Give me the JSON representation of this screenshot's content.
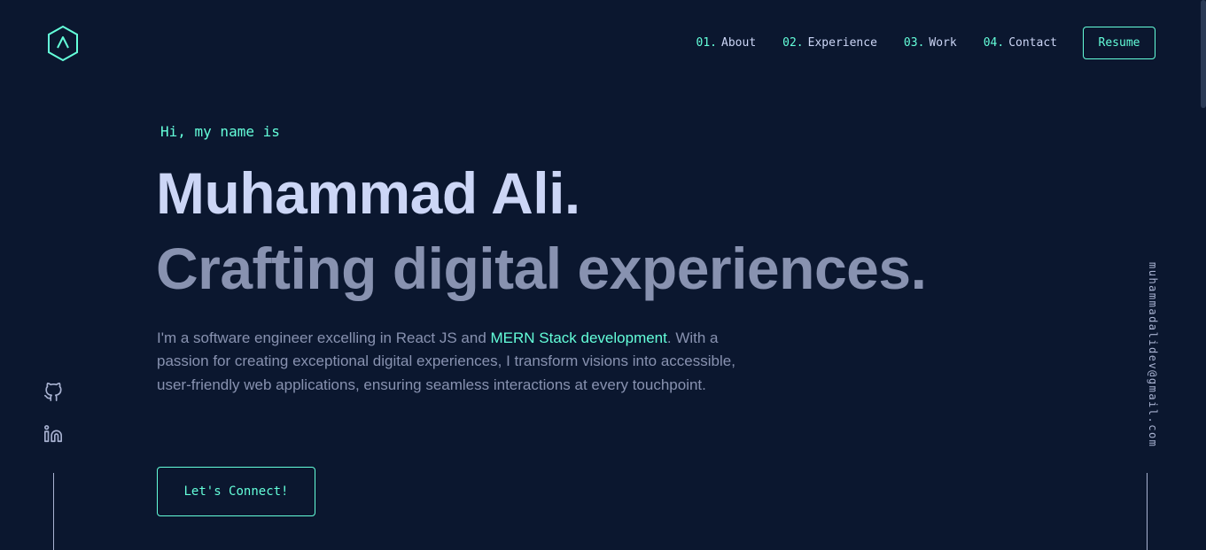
{
  "brand": {
    "logo_icon": "hexagon-logo-icon",
    "letter_icon": "chevron-up-icon"
  },
  "nav": {
    "items": [
      {
        "num": "01.",
        "label": "About"
      },
      {
        "num": "02.",
        "label": "Experience"
      },
      {
        "num": "03.",
        "label": "Work"
      },
      {
        "num": "04.",
        "label": "Contact"
      }
    ],
    "resume_label": "Resume"
  },
  "hero": {
    "greeting": "Hi, my name is",
    "name": "Muhammad Ali.",
    "tagline": "Crafting digital experiences.",
    "bio_part1": "I'm a software engineer excelling in React JS and ",
    "bio_highlight": "MERN Stack development",
    "bio_part2": ". With a passion for creating exceptional digital experiences, I transform visions into accessible, user-friendly web applications, ensuring seamless interactions at every touchpoint.",
    "cta_label": "Let's Connect!"
  },
  "socials": {
    "github_icon": "github-icon",
    "linkedin_icon": "linkedin-icon"
  },
  "email": "muhammadalidev@gmail.com",
  "colors": {
    "background": "#0b172f",
    "accent": "#64ffda",
    "heading": "#ccd6f6",
    "text": "#8892b0"
  }
}
